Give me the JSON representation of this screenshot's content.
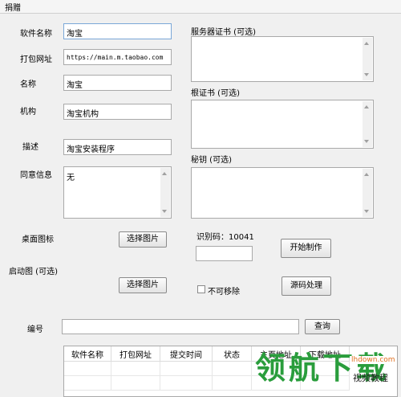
{
  "window": {
    "title": "捐赠"
  },
  "form": {
    "software_name": {
      "label": "软件名称",
      "value": "淘宝"
    },
    "package_url": {
      "label": "打包网址",
      "value": "https://main.m.taobao.com"
    },
    "name": {
      "label": "名称",
      "value": "淘宝"
    },
    "org": {
      "label": "机构",
      "value": "淘宝机构"
    },
    "desc": {
      "label": "描述",
      "value": "淘宝安装程序"
    },
    "consent": {
      "label": "同意信息",
      "value": "无"
    },
    "desktop_icon": {
      "label": "桌面图标",
      "button": "选择图片"
    },
    "splash": {
      "label": "启动图 (可选)",
      "button": "选择图片"
    },
    "number": {
      "label": "编号",
      "value": "",
      "button": "查询"
    }
  },
  "right": {
    "server_cert": {
      "label": "服务器证书 (可选)",
      "value": ""
    },
    "root_cert": {
      "label": "根证书 (可选)",
      "value": ""
    },
    "secret_key": {
      "label": "秘钥 (可选)",
      "value": ""
    },
    "id_code": {
      "label": "识别码：",
      "value": "10041"
    },
    "id_input": {
      "value": ""
    },
    "start_button": "开始制作",
    "non_removable": {
      "label": "不可移除",
      "checked": false
    },
    "source_button": "源码处理"
  },
  "table": {
    "columns": [
      "软件名称",
      "打包网址",
      "提交时间",
      "状态",
      "主页地址",
      "下载地址"
    ]
  },
  "watermark": {
    "text": "领航下载",
    "site": "lhdown.com",
    "sub": "视频教程"
  }
}
